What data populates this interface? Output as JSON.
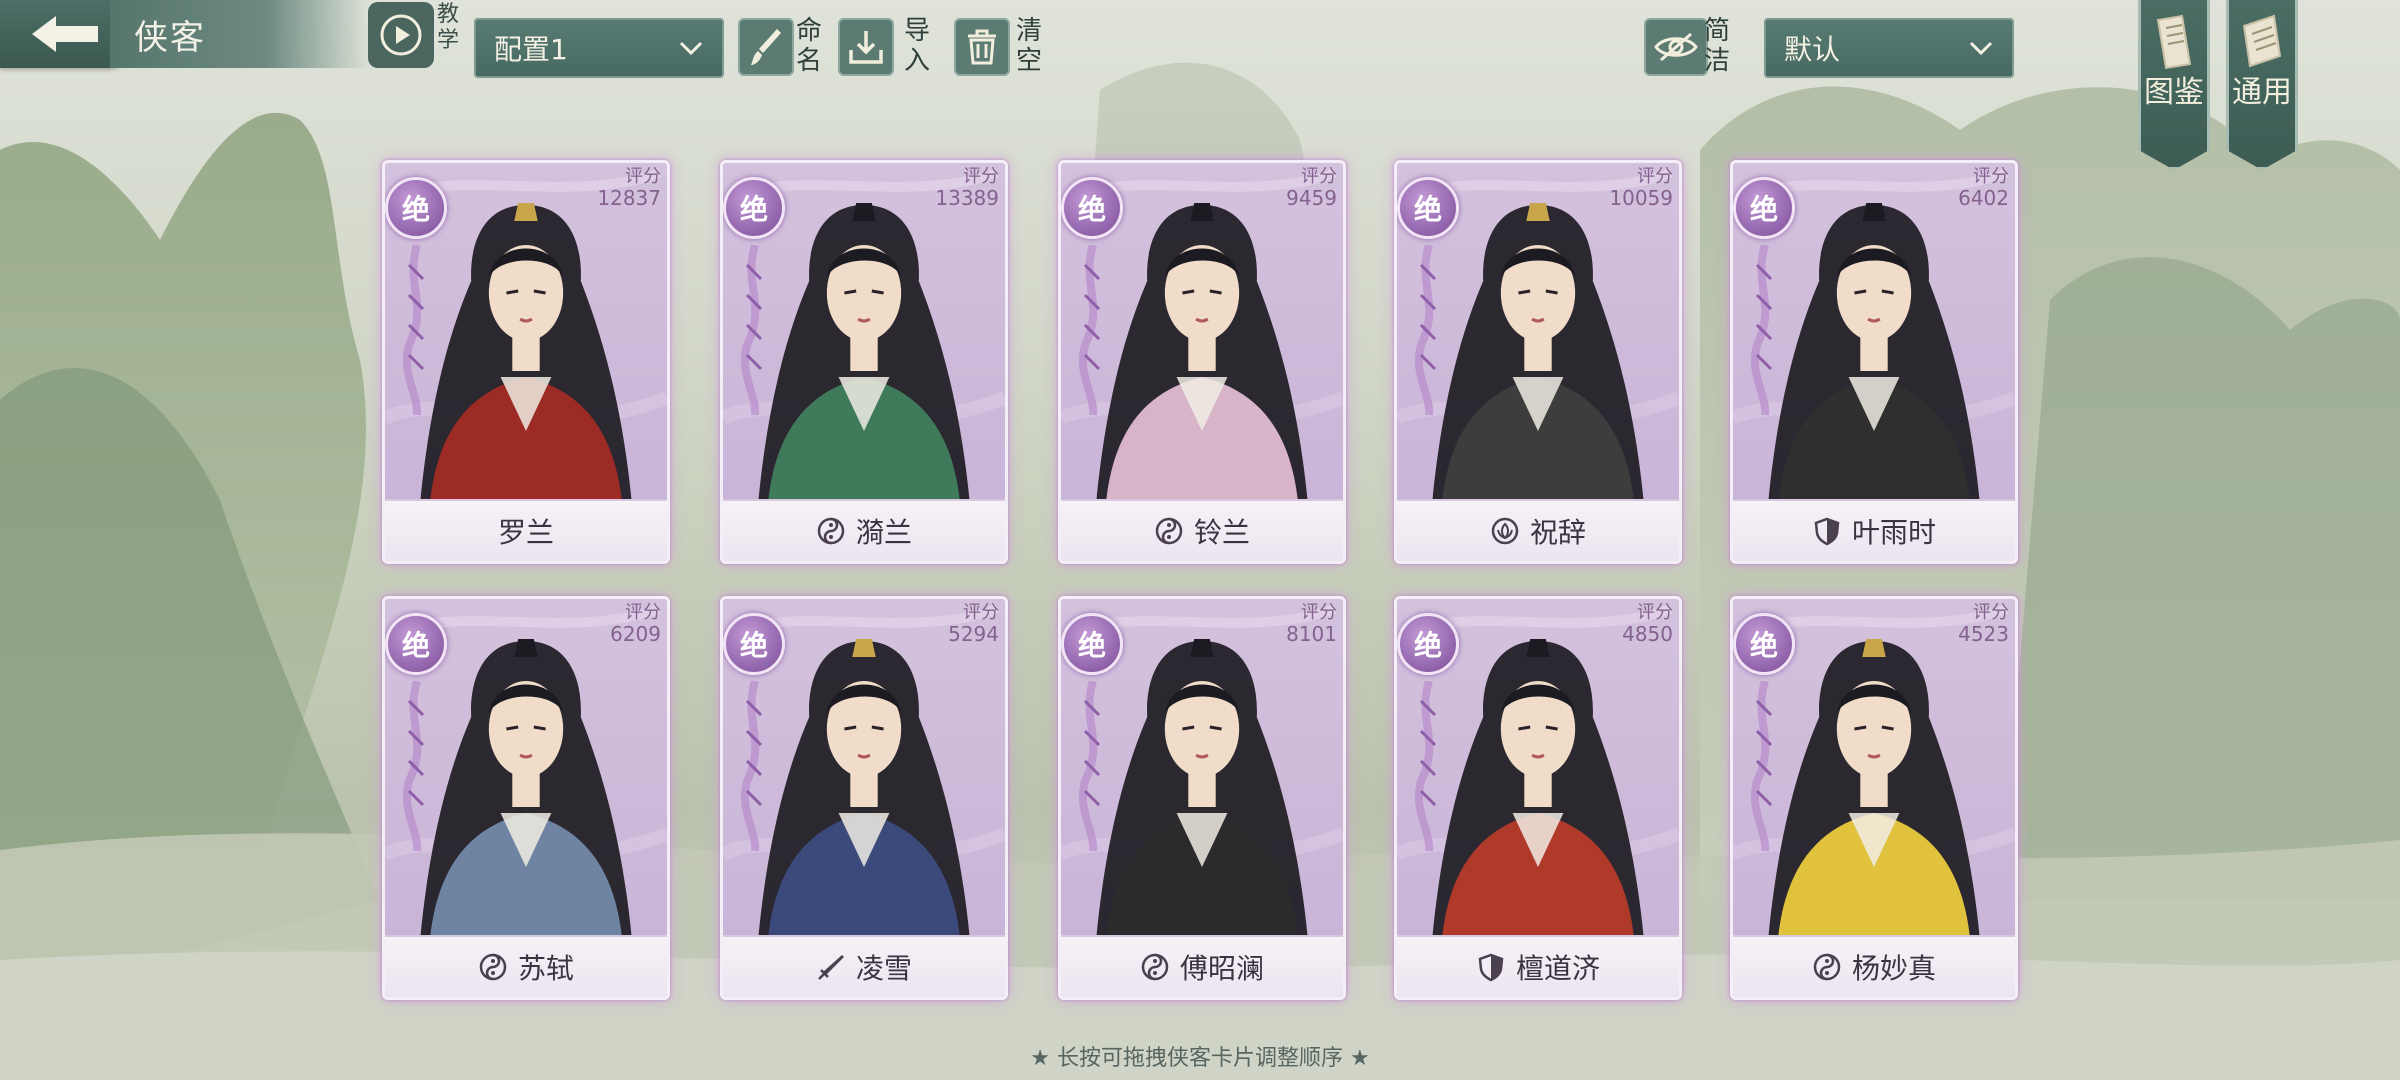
{
  "header": {
    "title": "侠客",
    "tutorial_label": "教学",
    "config_select": "配置1",
    "rename_label": "命名",
    "import_label": "导入",
    "clear_label": "清空",
    "simple_label": "简洁",
    "sort_select": "默认",
    "codex_label": "图鉴",
    "general_label": "通用"
  },
  "score_label": "评分",
  "rank_label": "绝",
  "cards": [
    {
      "name": "罗兰",
      "score": "12837",
      "sect_icon": "none",
      "outfit": "#9c2b25"
    },
    {
      "name": "漪兰",
      "score": "13389",
      "sect_icon": "yin-yang-icon",
      "outfit": "#3f7a5a"
    },
    {
      "name": "铃兰",
      "score": "9459",
      "sect_icon": "yin-yang-icon",
      "outfit": "#d7b4c8"
    },
    {
      "name": "祝辞",
      "score": "10059",
      "sect_icon": "lotus-icon",
      "outfit": "#3d3d3d"
    },
    {
      "name": "叶雨时",
      "score": "6402",
      "sect_icon": "shield-icon",
      "outfit": "#2f2f2f"
    },
    {
      "name": "苏轼",
      "score": "6209",
      "sect_icon": "yin-yang-icon",
      "outfit": "#6f84a3"
    },
    {
      "name": "凌雪",
      "score": "5294",
      "sect_icon": "sword-icon",
      "outfit": "#3b4a7a"
    },
    {
      "name": "傅昭澜",
      "score": "8101",
      "sect_icon": "yin-yang-icon",
      "outfit": "#2b2b2b"
    },
    {
      "name": "檀道济",
      "score": "4850",
      "sect_icon": "shield-icon",
      "outfit": "#b03a2a"
    },
    {
      "name": "杨妙真",
      "score": "4523",
      "sect_icon": "yin-yang-icon",
      "outfit": "#e0c23c"
    }
  ],
  "hint": "★ 长按可拖拽侠客卡片调整顺序 ★"
}
